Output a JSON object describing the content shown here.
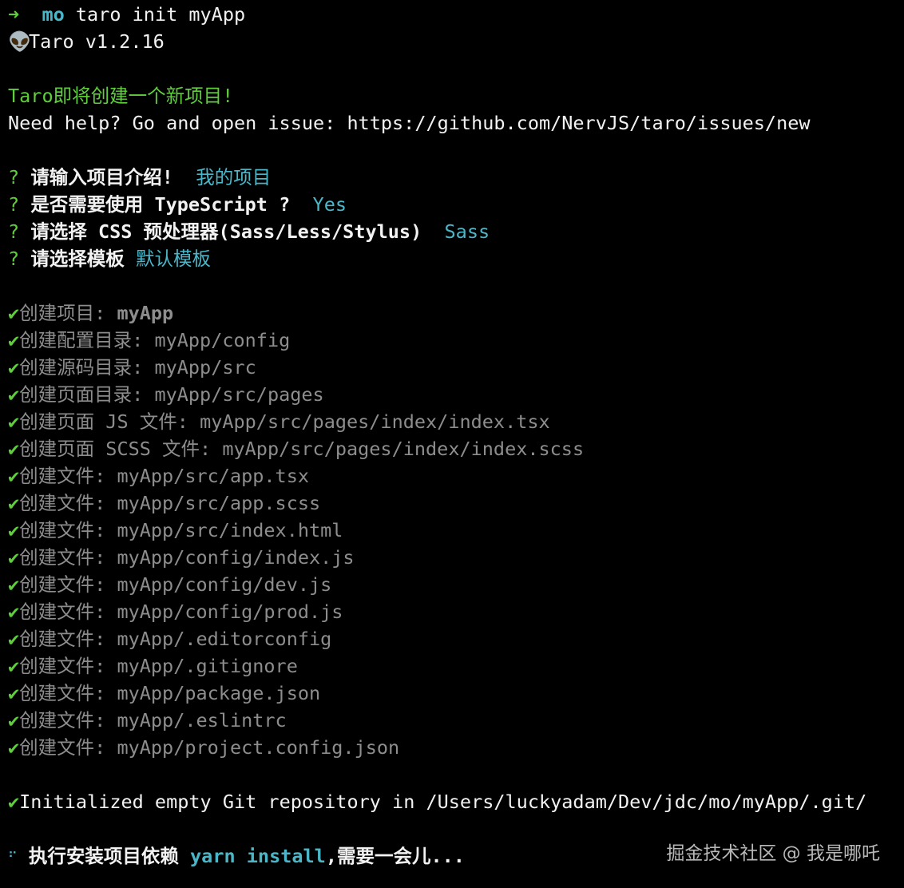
{
  "colors": {
    "background": "#000000",
    "green": "#5fce3c",
    "cyan": "#4cb6c9",
    "text": "#f2f2f2",
    "gray": "#8d8d8d"
  },
  "icons": {
    "prompt_arrow": "arrow-right-icon",
    "alien": "alien-icon",
    "check": "check-icon",
    "spinner": "spinner-icon"
  },
  "prompt": {
    "arrow": "➜",
    "dir": "mo",
    "command": " taro init myApp"
  },
  "version": {
    "alien": "👽",
    "text": "Taro v1.2.16"
  },
  "intro": {
    "creating": "Taro即将创建一个新项目!",
    "help": "Need help? Go and open issue: https://github.com/NervJS/taro/issues/new"
  },
  "questions": [
    {
      "mark": "?",
      "question": "请输入项目介绍!",
      "answer": "我的项目"
    },
    {
      "mark": "?",
      "question": "是否需要使用 TypeScript ?",
      "answer": "Yes"
    },
    {
      "mark": "?",
      "question": "请选择 CSS 预处理器(Sass/Less/Stylus)",
      "answer": "Sass"
    },
    {
      "mark": "?",
      "question": "请选择模板",
      "answer": "默认模板"
    }
  ],
  "created_project": {
    "check": "✔",
    "label": "创建项目:",
    "path": "myApp"
  },
  "created_items": [
    {
      "check": "✔",
      "label": "创建配置目录:",
      "path": "myApp/config"
    },
    {
      "check": "✔",
      "label": "创建源码目录:",
      "path": "myApp/src"
    },
    {
      "check": "✔",
      "label": "创建页面目录:",
      "path": "myApp/src/pages"
    },
    {
      "check": "✔",
      "label": "创建页面 JS 文件:",
      "path": "myApp/src/pages/index/index.tsx"
    },
    {
      "check": "✔",
      "label": "创建页面 SCSS 文件:",
      "path": "myApp/src/pages/index/index.scss"
    },
    {
      "check": "✔",
      "label": "创建文件:",
      "path": "myApp/src/app.tsx"
    },
    {
      "check": "✔",
      "label": "创建文件:",
      "path": "myApp/src/app.scss"
    },
    {
      "check": "✔",
      "label": "创建文件:",
      "path": "myApp/src/index.html"
    },
    {
      "check": "✔",
      "label": "创建文件:",
      "path": "myApp/config/index.js"
    },
    {
      "check": "✔",
      "label": "创建文件:",
      "path": "myApp/config/dev.js"
    },
    {
      "check": "✔",
      "label": "创建文件:",
      "path": "myApp/config/prod.js"
    },
    {
      "check": "✔",
      "label": "创建文件:",
      "path": "myApp/.editorconfig"
    },
    {
      "check": "✔",
      "label": "创建文件:",
      "path": "myApp/.gitignore"
    },
    {
      "check": "✔",
      "label": "创建文件:",
      "path": "myApp/package.json"
    },
    {
      "check": "✔",
      "label": "创建文件:",
      "path": "myApp/.eslintrc"
    },
    {
      "check": "✔",
      "label": "创建文件:",
      "path": "myApp/project.config.json"
    }
  ],
  "git": {
    "check": "✔",
    "text": "Initialized empty Git repository in /Users/luckyadam/Dev/jdc/mo/myApp/.git/"
  },
  "install": {
    "spinner": "⠋",
    "prefix": "执行安装项目依赖",
    "command": "yarn install",
    "suffix": ",需要一会儿..."
  },
  "watermark": "掘金技术社区 @ 我是哪吒"
}
